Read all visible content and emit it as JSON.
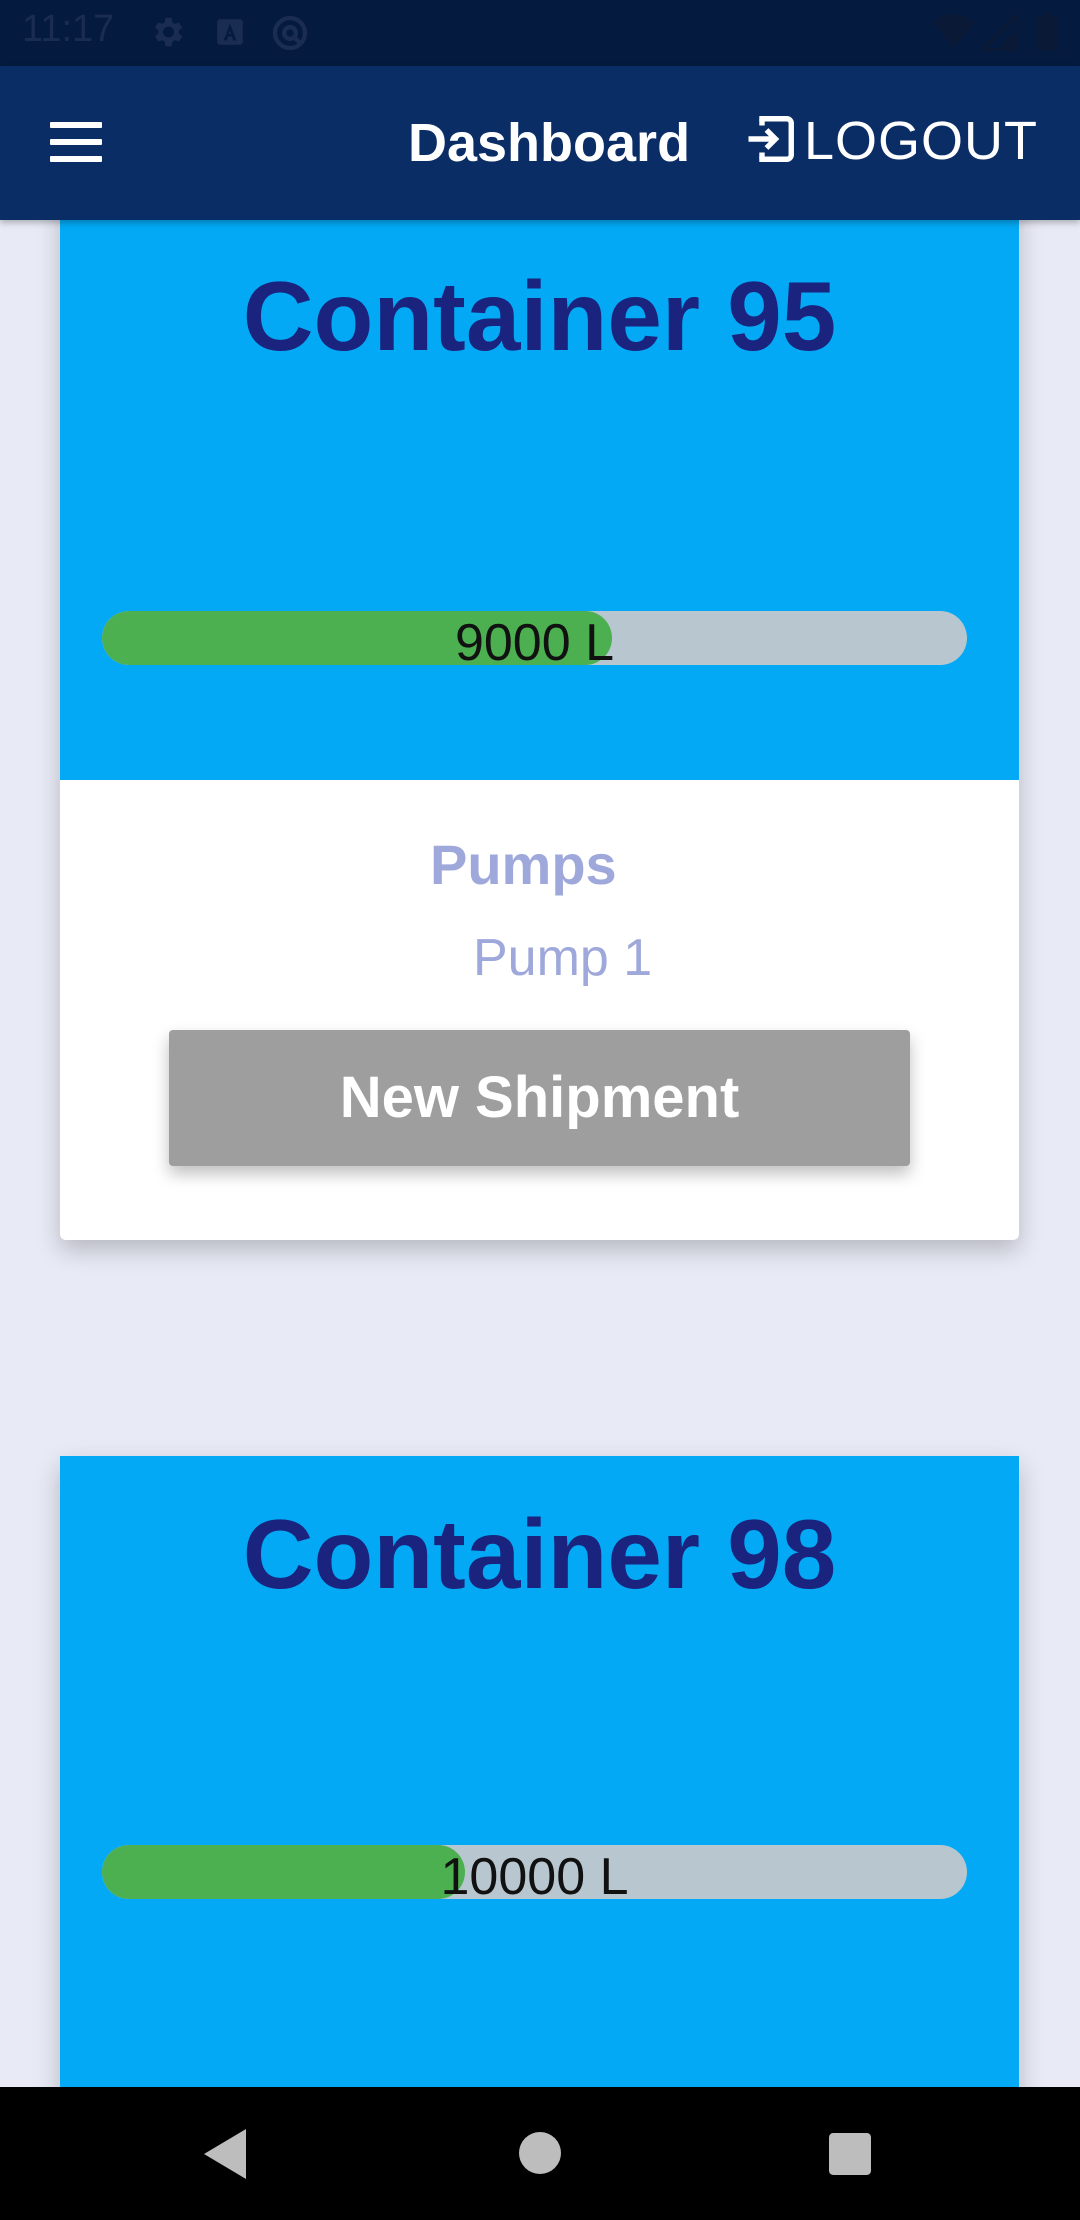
{
  "status_bar": {
    "time": "11:17",
    "icons": [
      "settings-icon",
      "text-a-icon",
      "sync-icon",
      "wifi-icon",
      "signal-icon",
      "battery-icon"
    ]
  },
  "app_bar": {
    "menu_icon": "hamburger-icon",
    "title": "Dashboard",
    "logout_label": "LOGOUT",
    "logout_icon": "login-arrow-icon"
  },
  "colors": {
    "status_bar": "#051a3f",
    "app_bar": "#0b2d66",
    "background": "#e8eaf6",
    "card_header": "#03a9f4",
    "card_title": "#1a237e",
    "bar_track": "#b8c7cf",
    "bar_fill": "#4caf50",
    "secondary_text": "#9fa8da",
    "button": "#9e9e9e"
  },
  "containers": [
    {
      "title": "Container 95",
      "level_label": "9000 L",
      "fill_fraction": 0.59,
      "pumps_heading": "Pumps",
      "pumps": [
        "Pump 1"
      ],
      "button_label": "New Shipment"
    },
    {
      "title": "Container 98",
      "level_label": "10000 L",
      "fill_fraction": 0.42
    }
  ],
  "nav_bar": {
    "buttons": [
      "back-icon",
      "home-icon",
      "recents-icon"
    ]
  }
}
